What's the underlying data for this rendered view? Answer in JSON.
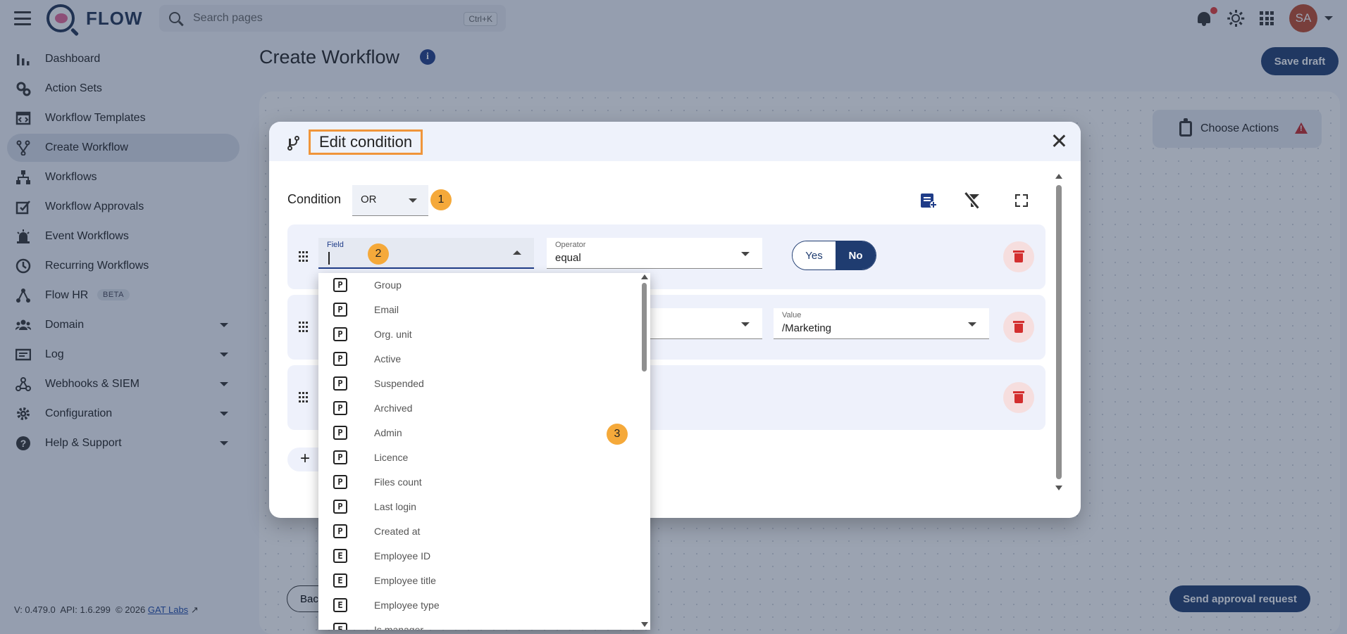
{
  "app": {
    "name": "FLOW"
  },
  "search": {
    "placeholder": "Search pages",
    "shortcut": "Ctrl+K"
  },
  "user": {
    "initials": "SA",
    "avatar_color": "#c0492b"
  },
  "sidebar": {
    "items": [
      {
        "label": "Dashboard",
        "icon": "bar-chart-icon"
      },
      {
        "label": "Action Sets",
        "icon": "gears-icon"
      },
      {
        "label": "Workflow Templates",
        "icon": "template-icon"
      },
      {
        "label": "Create Workflow",
        "icon": "branch-icon",
        "active": true
      },
      {
        "label": "Workflows",
        "icon": "hierarchy-icon"
      },
      {
        "label": "Workflow Approvals",
        "icon": "approval-icon"
      },
      {
        "label": "Event Workflows",
        "icon": "alarm-icon"
      },
      {
        "label": "Recurring Workflows",
        "icon": "clock-icon"
      },
      {
        "label": "Flow HR",
        "icon": "flow-hr-icon",
        "badge": "BETA"
      },
      {
        "label": "Domain",
        "icon": "people-icon",
        "expandable": true
      },
      {
        "label": "Log",
        "icon": "log-icon",
        "expandable": true
      },
      {
        "label": "Webhooks & SIEM",
        "icon": "webhook-icon",
        "expandable": true
      },
      {
        "label": "Configuration",
        "icon": "gear-icon",
        "expandable": true
      },
      {
        "label": "Help & Support",
        "icon": "help-icon",
        "expandable": true
      }
    ],
    "footer": {
      "version": "V: 0.479.0",
      "api": "API: 1.6.299",
      "copyright": "© 2026",
      "link": "GAT Labs"
    }
  },
  "main": {
    "title": "Create Workflow",
    "save_draft": "Save draft",
    "choose_actions": "Choose Actions",
    "back": "Back",
    "send_approval": "Send approval request"
  },
  "modal": {
    "title": "Edit condition",
    "condition_label": "Condition",
    "condition_value": "OR",
    "badges": [
      "1",
      "2",
      "3"
    ],
    "rows": [
      {
        "field_label": "Field",
        "field_value": "",
        "operator_label": "Operator",
        "operator_value": "equal",
        "toggle": {
          "yes": "Yes",
          "no": "No",
          "selected": "No"
        }
      },
      {
        "value_label": "Value",
        "value_value": "/Marketing"
      },
      {}
    ],
    "add_label": "+"
  },
  "dropdown": {
    "items": [
      {
        "tag": "P",
        "label": "Group"
      },
      {
        "tag": "P",
        "label": "Email"
      },
      {
        "tag": "P",
        "label": "Org. unit"
      },
      {
        "tag": "P",
        "label": "Active"
      },
      {
        "tag": "P",
        "label": "Suspended"
      },
      {
        "tag": "P",
        "label": "Archived"
      },
      {
        "tag": "P",
        "label": "Admin"
      },
      {
        "tag": "P",
        "label": "Licence"
      },
      {
        "tag": "P",
        "label": "Files count"
      },
      {
        "tag": "P",
        "label": "Last login"
      },
      {
        "tag": "P",
        "label": "Created at"
      },
      {
        "tag": "E",
        "label": "Employee ID"
      },
      {
        "tag": "E",
        "label": "Employee title"
      },
      {
        "tag": "E",
        "label": "Employee type"
      },
      {
        "tag": "E",
        "label": "Is manager"
      }
    ]
  },
  "colors": {
    "primary": "#1f3c70",
    "accent_badge": "#f5a93a",
    "highlight_border": "#f0953a",
    "delete": "#d32f2f"
  }
}
